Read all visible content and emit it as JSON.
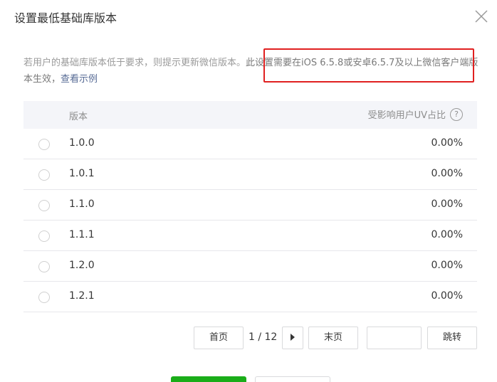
{
  "dialog": {
    "title": "设置最低基础库版本"
  },
  "description": {
    "part1": "若用户的基础库版本低于要求，则提示更新微信版本。",
    "part2": "此设置需要在iOS 6.5.8或安卓6.5.7及以上微信客户端版本生效，",
    "link": "查看示例"
  },
  "table": {
    "header_version": "版本",
    "header_impact": "受影响用户UV占比",
    "help_symbol": "?",
    "rows": [
      {
        "version": "1.0.0",
        "impact": "0.00%"
      },
      {
        "version": "1.0.1",
        "impact": "0.00%"
      },
      {
        "version": "1.1.0",
        "impact": "0.00%"
      },
      {
        "version": "1.1.1",
        "impact": "0.00%"
      },
      {
        "version": "1.2.0",
        "impact": "0.00%"
      },
      {
        "version": "1.2.1",
        "impact": "0.00%"
      }
    ]
  },
  "pagination": {
    "first_label": "首页",
    "page_info": "1 / 12",
    "last_label": "末页",
    "jump_label": "跳转",
    "jump_value": ""
  },
  "colors": {
    "highlight_border": "#e02020",
    "link": "#576b95",
    "primary_button": "#1aad19"
  }
}
